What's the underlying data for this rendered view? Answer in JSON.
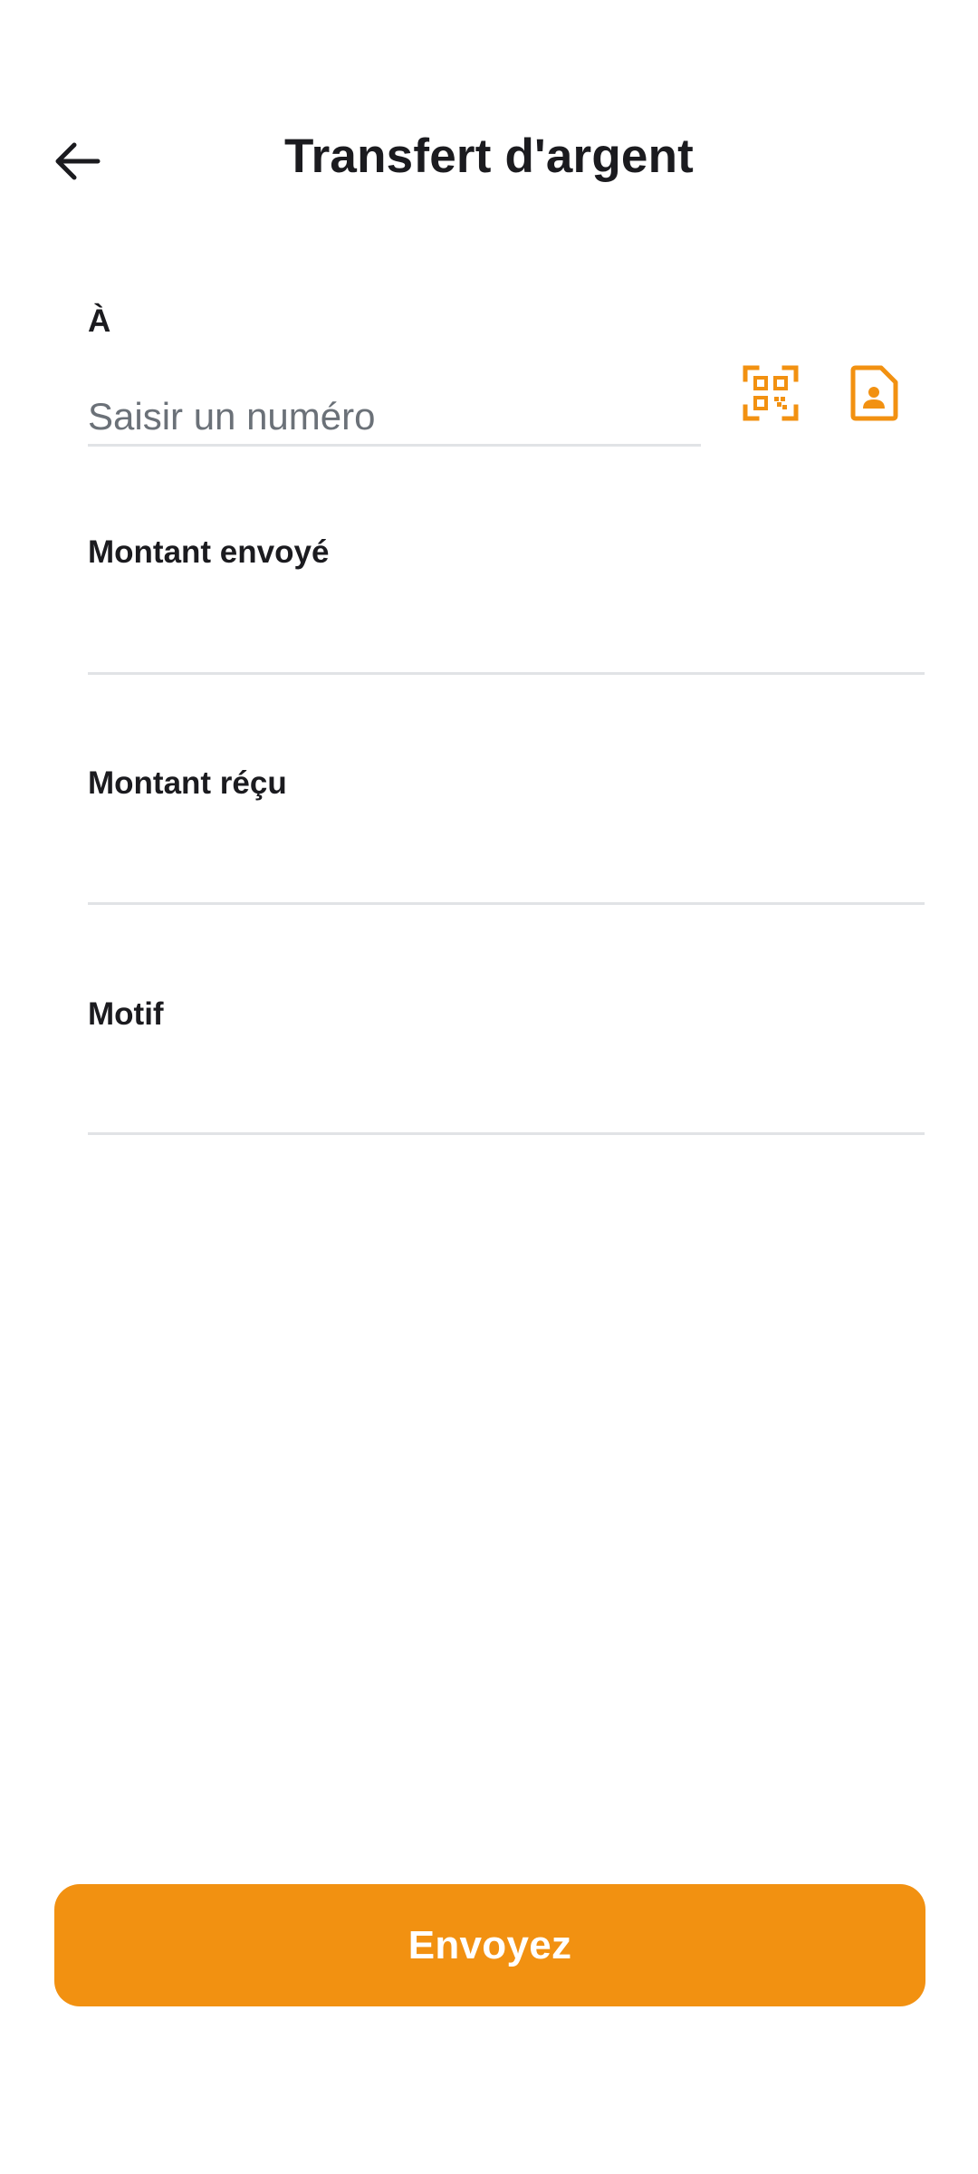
{
  "header": {
    "title": "Transfert d'argent",
    "back_icon": "arrow-left-icon"
  },
  "form": {
    "recipient": {
      "label": "À",
      "placeholder": "Saisir un numéro",
      "value": "",
      "qr_icon": "qr-code-scan-icon",
      "contact_icon": "contact-book-icon"
    },
    "amount_sent": {
      "label": "Montant envoyé",
      "value": ""
    },
    "amount_received": {
      "label": "Montant réçu",
      "value": ""
    },
    "reason": {
      "label": "Motif",
      "value": ""
    }
  },
  "actions": {
    "send_label": "Envoyez"
  },
  "colors": {
    "accent": "#f29111",
    "text": "#1b1b1f",
    "placeholder": "#6b7178",
    "divider": "#e1e3e6"
  }
}
